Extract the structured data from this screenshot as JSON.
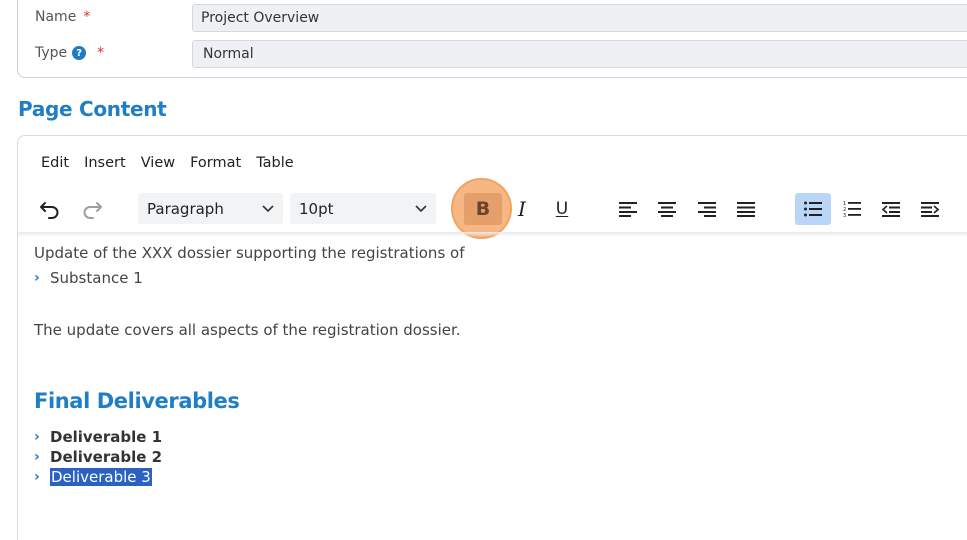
{
  "form": {
    "name_label": "Name",
    "name_value": "Project Overview",
    "type_label": "Type",
    "type_value": "Normal",
    "required_mark": "*",
    "help_glyph": "?"
  },
  "section_title": "Page Content",
  "editor": {
    "menu": [
      "Edit",
      "Insert",
      "View",
      "Format",
      "Table"
    ],
    "block_format": "Paragraph",
    "font_size": "10pt",
    "bold_glyph": "B",
    "italic_glyph": "I",
    "underline_glyph": "U",
    "icons": [
      "undo-icon",
      "redo-icon",
      "align-left-icon",
      "align-center-icon",
      "align-right-icon",
      "justify-icon",
      "bullet-list-icon",
      "numbered-list-icon",
      "outdent-icon",
      "indent-icon"
    ],
    "active_color": "#b9d6f6",
    "highlight_color": "#f6aa6e"
  },
  "content": {
    "line1": "Update of the XXX dossier supporting the registrations of",
    "item1": "Substance 1",
    "line2": "The update covers all aspects of the registration dossier.",
    "heading": "Final Deliverables",
    "deliverables": [
      "Deliverable 1",
      "Deliverable 2",
      "Deliverable 3"
    ]
  }
}
